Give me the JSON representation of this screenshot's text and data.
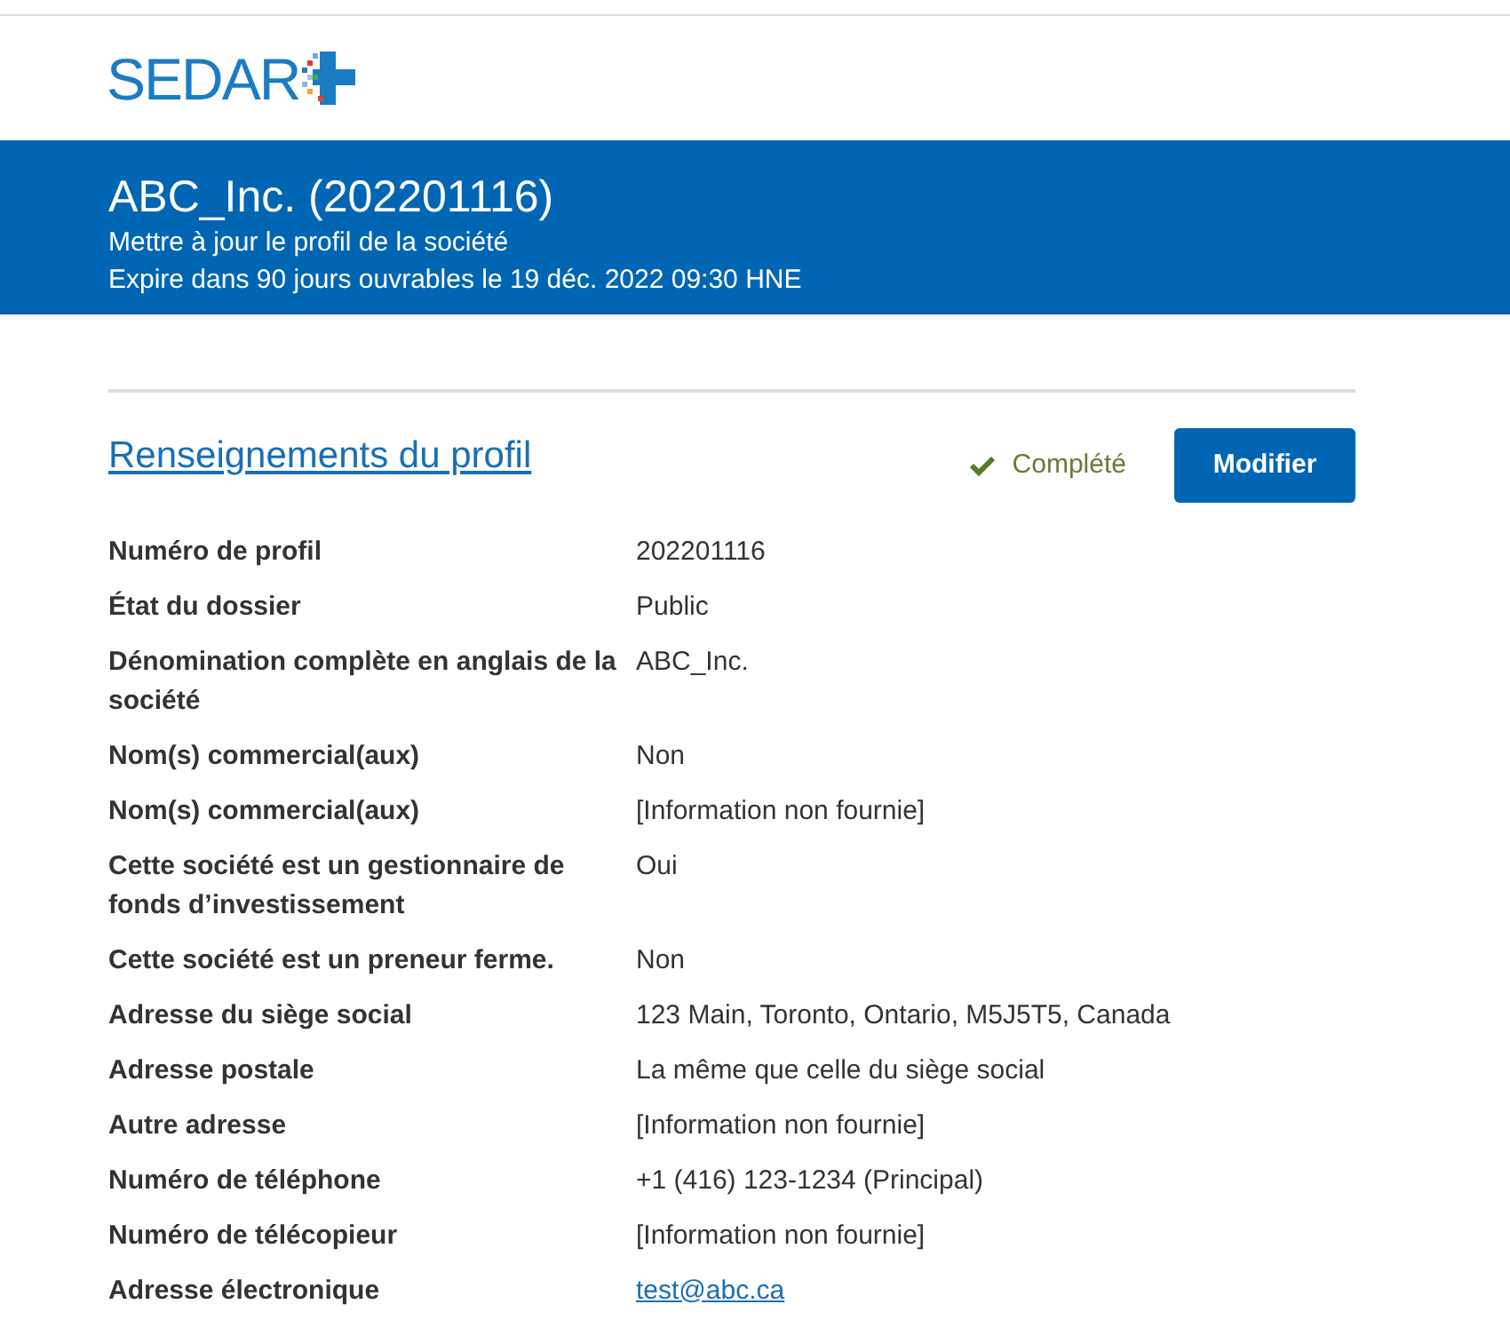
{
  "logo": {
    "text": "SEDAR"
  },
  "banner": {
    "title": "ABC_Inc. (202201116)",
    "subtitle": "Mettre à jour le profil de la société",
    "expiry": "Expire dans 90 jours ouvrables le 19 déc. 2022 09:30 HNE"
  },
  "section": {
    "title": "Renseignements du profil",
    "status": "Complété",
    "completed": true,
    "button": "Modifier"
  },
  "rows": [
    {
      "label": "Numéro de profil",
      "value": "202201116",
      "kind": "text"
    },
    {
      "label": "État du dossier",
      "value": "Public",
      "kind": "text"
    },
    {
      "label": "Dénomination complète en anglais de la société",
      "value": "ABC_Inc.",
      "kind": "text"
    },
    {
      "label": "Nom(s) commercial(aux)",
      "value": "Non",
      "kind": "text"
    },
    {
      "label": "Nom(s) commercial(aux)",
      "value": "[Information non fournie]",
      "kind": "text"
    },
    {
      "label": "Cette société est un gestionnaire de fonds d’investissement",
      "value": "Oui",
      "kind": "text"
    },
    {
      "label": "Cette société est un preneur ferme.",
      "value": "Non",
      "kind": "text"
    },
    {
      "label": "Adresse du siège social",
      "value": "123 Main, Toronto, Ontario, M5J5T5, Canada",
      "kind": "text"
    },
    {
      "label": "Adresse postale",
      "value": "La même que celle du siège social",
      "kind": "text"
    },
    {
      "label": "Autre adresse",
      "value": "[Information non fournie]",
      "kind": "text"
    },
    {
      "label": "Numéro de téléphone",
      "value": "+1 (416) 123-1234 (Principal)",
      "kind": "text"
    },
    {
      "label": "Numéro de télécopieur",
      "value": "[Information non fournie]",
      "kind": "text"
    },
    {
      "label": "Adresse électronique",
      "value": "test@abc.ca",
      "kind": "link"
    }
  ]
}
